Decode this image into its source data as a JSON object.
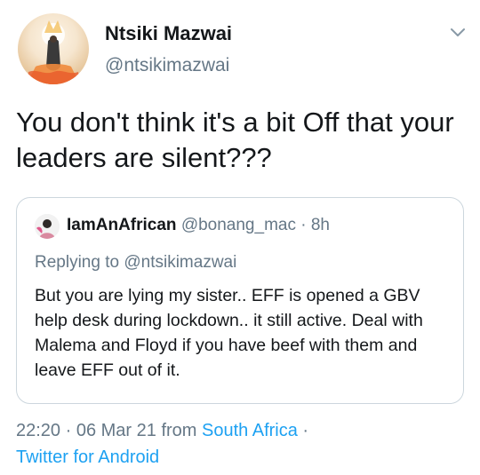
{
  "author": {
    "name": "Ntsiki Mazwai",
    "handle": "@ntsikimazwai"
  },
  "tweet": {
    "text": "You don't think it's a bit Off that your leaders are silent???"
  },
  "quoted_tweet": {
    "name": "IamAnAfrican",
    "handle": "@bonang_mac",
    "separator": " · ",
    "time": "8h",
    "replying_prefix": "Replying to ",
    "replying_to": "@ntsikimazwai",
    "body": "But you are lying my sister.. EFF is opened a GBV help desk during lockdown.. it still active. Deal with Malema and Floyd if you have beef with them and leave EFF out of it."
  },
  "meta": {
    "time": "22:20",
    "dot": " · ",
    "date": "06 Mar 21",
    "from_prefix": " from ",
    "location": "South Africa",
    "trailing_dot": " ·",
    "source": "Twitter for Android"
  },
  "icons": {
    "menu": "chevron-down-icon",
    "avatar": "avatar",
    "quoted_avatar": "avatar"
  },
  "colors": {
    "text": "#14171a",
    "secondary": "#657786",
    "link": "#1da1f2",
    "border": "#ccd6dd"
  }
}
